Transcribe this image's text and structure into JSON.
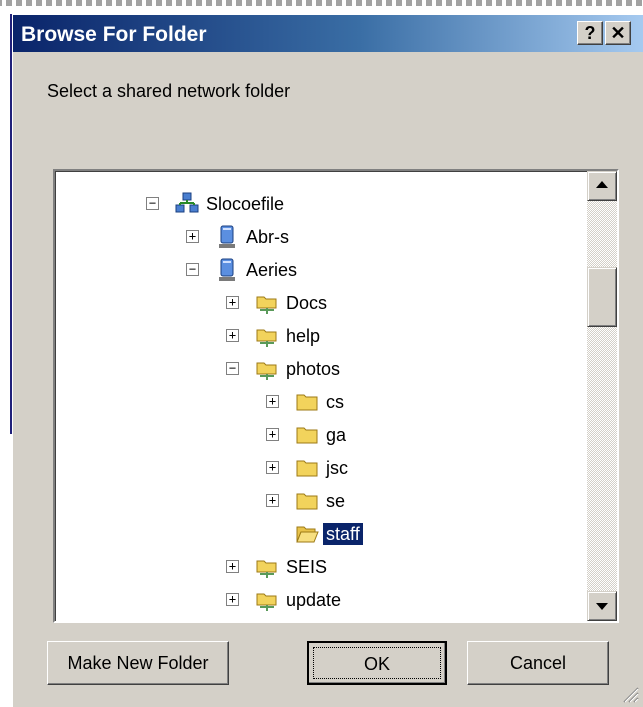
{
  "window": {
    "title": "Browse For Folder",
    "help_label": "?",
    "close_label": "✕"
  },
  "prompt": "Select a shared network folder",
  "tree": {
    "items": [
      {
        "label": "Slocoefile",
        "icon": "network-computer-icon",
        "expander": "−"
      },
      {
        "label": "Abr-s",
        "icon": "share-drive-icon",
        "expander": "+"
      },
      {
        "label": "Aeries",
        "icon": "share-drive-icon",
        "expander": "−"
      },
      {
        "label": "Docs",
        "icon": "shared-folder-icon",
        "expander": "+"
      },
      {
        "label": "help",
        "icon": "shared-folder-icon",
        "expander": "+"
      },
      {
        "label": "photos",
        "icon": "shared-folder-icon",
        "expander": "−"
      },
      {
        "label": "cs",
        "icon": "folder-icon",
        "expander": "+"
      },
      {
        "label": "ga",
        "icon": "folder-icon",
        "expander": "+"
      },
      {
        "label": "jsc",
        "icon": "folder-icon",
        "expander": "+"
      },
      {
        "label": "se",
        "icon": "folder-icon",
        "expander": "+"
      },
      {
        "label": "staff",
        "icon": "open-folder-icon",
        "expander": ""
      },
      {
        "label": "SEIS",
        "icon": "shared-folder-icon",
        "expander": "+"
      },
      {
        "label": "update",
        "icon": "shared-folder-icon",
        "expander": "+"
      }
    ],
    "selected": "staff"
  },
  "buttons": {
    "make_new_folder": "Make New Folder",
    "ok": "OK",
    "cancel": "Cancel"
  },
  "colors": {
    "title_bar": "#0a246a",
    "selection": "#0a246a",
    "face": "#d4d0c8"
  }
}
